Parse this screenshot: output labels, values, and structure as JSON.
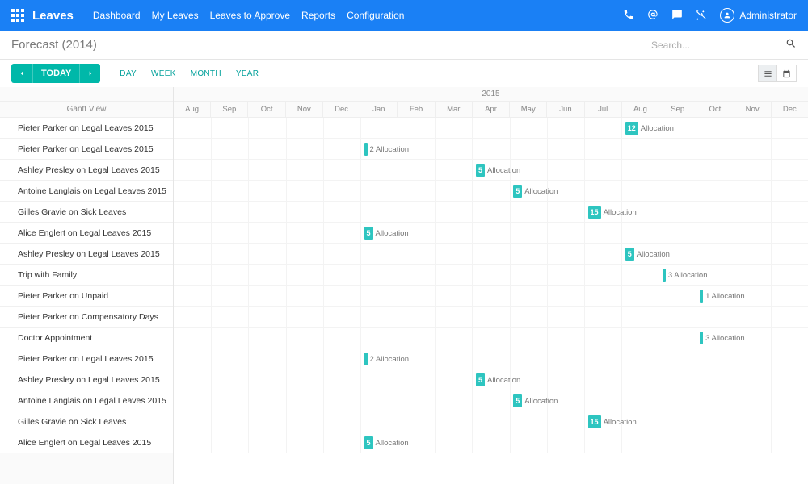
{
  "colors": {
    "primary": "#1a80f5",
    "accent": "#00b8a9",
    "chip": "#2ec5c0"
  },
  "header": {
    "brand": "Leaves",
    "nav": [
      "Dashboard",
      "My Leaves",
      "Leaves to Approve",
      "Reports",
      "Configuration"
    ],
    "user": "Administrator"
  },
  "subbar": {
    "title": "Forecast (2014)",
    "search_placeholder": "Search..."
  },
  "controls": {
    "today": "TODAY",
    "ranges": [
      "DAY",
      "WEEK",
      "MONTH",
      "YEAR"
    ]
  },
  "gantt": {
    "sidebar_label": "Gantt View",
    "year_label": "2015",
    "months": [
      "Aug",
      "Sep",
      "Oct",
      "Nov",
      "Dec",
      "Jan",
      "Feb",
      "Mar",
      "Apr",
      "May",
      "Jun",
      "Jul",
      "Aug",
      "Sep",
      "Oct",
      "Nov",
      "Dec"
    ],
    "allocation_word": "Allocation",
    "rows": [
      {
        "label": "Pieter Parker on Legal Leaves 2015",
        "month": 12,
        "value": "12"
      },
      {
        "label": "Pieter Parker on Legal Leaves 2015",
        "month": 5,
        "value": "2",
        "thin": true
      },
      {
        "label": "Ashley Presley on Legal Leaves 2015",
        "month": 8,
        "value": "5"
      },
      {
        "label": "Antoine Langlais on Legal Leaves 2015",
        "month": 9,
        "value": "5"
      },
      {
        "label": "Gilles Gravie on Sick Leaves",
        "month": 11,
        "value": "15"
      },
      {
        "label": "Alice Englert on Legal Leaves 2015",
        "month": 5,
        "value": "5"
      },
      {
        "label": "Ashley Presley on Legal Leaves 2015",
        "month": 12,
        "value": "5"
      },
      {
        "label": "Trip with Family",
        "month": 13,
        "value": "3",
        "thin": true
      },
      {
        "label": "Pieter Parker on Unpaid",
        "month": 14,
        "value": "1",
        "thin": true
      },
      {
        "label": "Pieter Parker on Compensatory Days",
        "month": null
      },
      {
        "label": "Doctor Appointment",
        "month": 14,
        "value": "3",
        "thin": true
      },
      {
        "label": "Pieter Parker on Legal Leaves 2015",
        "month": 5,
        "value": "2",
        "thin": true
      },
      {
        "label": "Ashley Presley on Legal Leaves 2015",
        "month": 8,
        "value": "5"
      },
      {
        "label": "Antoine Langlais on Legal Leaves 2015",
        "month": 9,
        "value": "5"
      },
      {
        "label": "Gilles Gravie on Sick Leaves",
        "month": 11,
        "value": "15"
      },
      {
        "label": "Alice Englert on Legal Leaves 2015",
        "month": 5,
        "value": "5"
      }
    ]
  }
}
